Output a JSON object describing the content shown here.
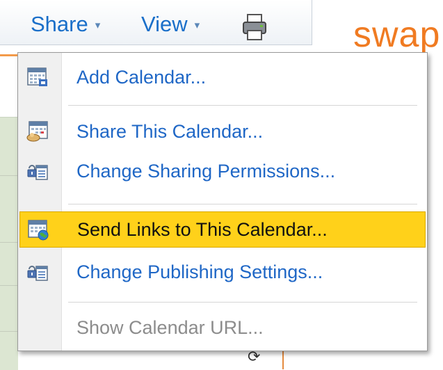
{
  "toolbar": {
    "share_label": "Share",
    "view_label": "View",
    "caret": "▾",
    "print_icon": "printer-icon"
  },
  "brand_text": "swap",
  "menu": {
    "items": [
      {
        "label": "Add Calendar...",
        "icon": "calendar-add-icon",
        "enabled": true,
        "highlighted": false
      },
      {
        "label": "Share This Calendar...",
        "icon": "calendar-share-icon",
        "enabled": true,
        "highlighted": false
      },
      {
        "label": "Change Sharing Permissions...",
        "icon": "permissions-icon",
        "enabled": true,
        "highlighted": false
      },
      {
        "label": "Send Links to This Calendar...",
        "icon": "calendar-globe-icon",
        "enabled": true,
        "highlighted": true
      },
      {
        "label": "Change Publishing Settings...",
        "icon": "permissions-icon",
        "enabled": true,
        "highlighted": false
      },
      {
        "label": "Show Calendar URL...",
        "icon": "",
        "enabled": false,
        "highlighted": false
      }
    ]
  },
  "refresh_icon": "⟳",
  "colors": {
    "link_blue": "#1f67c6",
    "highlight": "#ffd11a",
    "brand_orange": "#f07b22",
    "disabled_gray": "#8c8c8c"
  }
}
